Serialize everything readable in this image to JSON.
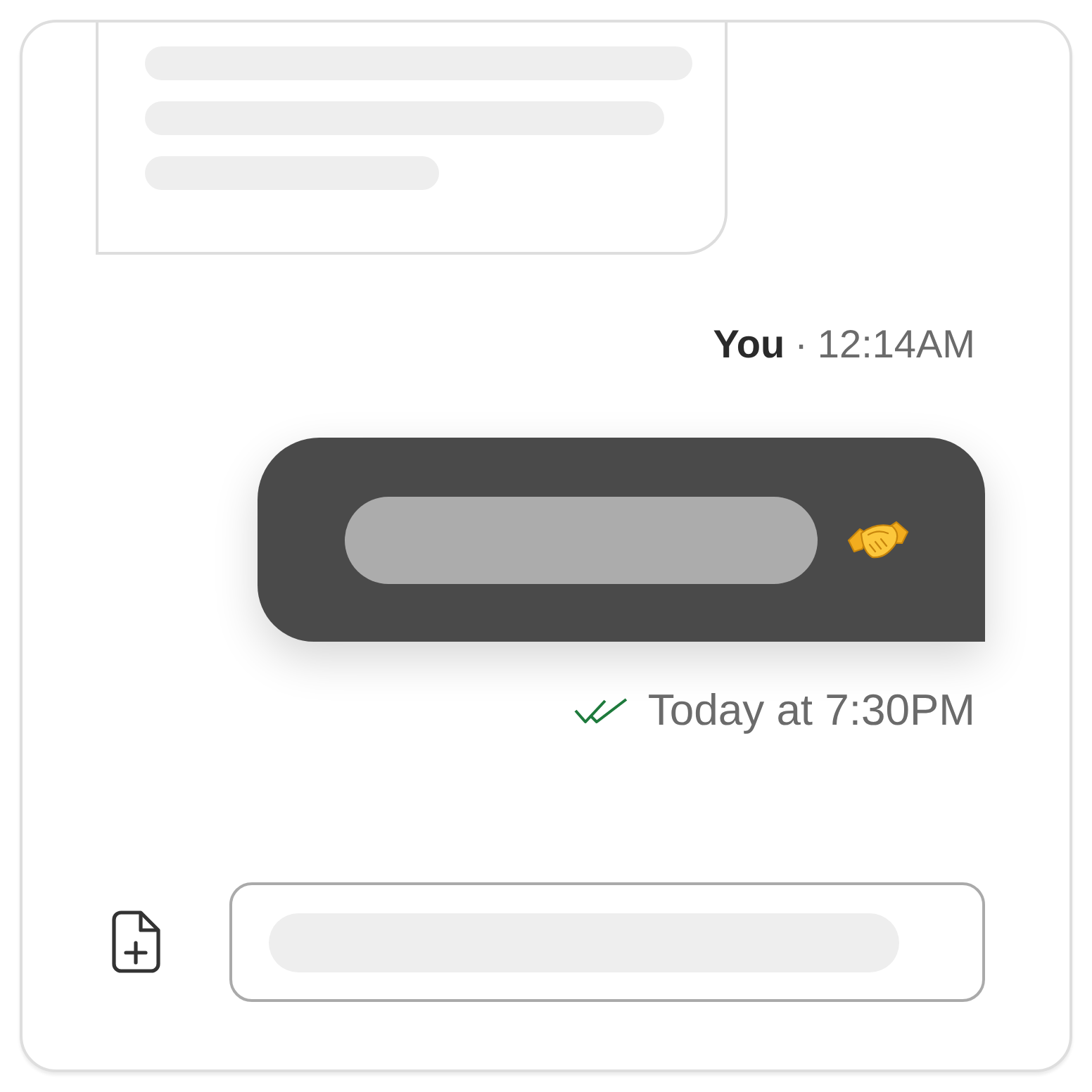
{
  "messages": [
    {
      "kind": "received",
      "lines": [
        {
          "kind": "skeleton"
        },
        {
          "kind": "skeleton"
        },
        {
          "kind": "skeleton"
        }
      ]
    },
    {
      "kind": "sent",
      "sender": "You",
      "separator": "·",
      "time": "12:14AM",
      "content": [
        {
          "kind": "skeleton"
        },
        {
          "kind": "emoji"
        }
      ],
      "read": true,
      "receipt_time": "Today at 7:30PM"
    }
  ],
  "composer": {
    "field": {
      "kind": "skeleton"
    }
  }
}
